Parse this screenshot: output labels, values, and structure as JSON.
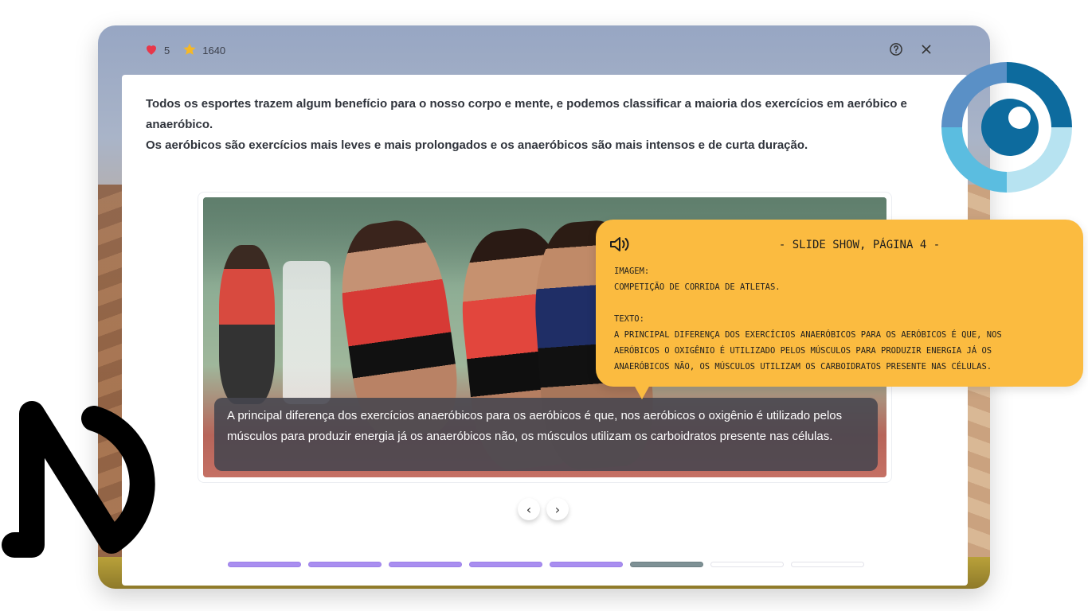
{
  "status": {
    "lives": "5",
    "points": "1640"
  },
  "intro": {
    "line1": "Todos os esportes trazem algum benefício para o nosso corpo e mente, e podemos classificar a maioria dos exercícios em aeróbico e anaeróbico.",
    "line2": "Os aeróbicos são exercícios mais leves e mais prolongados e os anaeróbicos são mais intensos e de curta duração."
  },
  "slide": {
    "caption": "A principal diferença dos exercícios anaeróbicos para os aeróbicos é que, nos aeróbicos o oxigênio é utilizado pelos músculos para produzir energia já os anaeróbicos não, os músculos utilizam os carboidratos presente nas células."
  },
  "nav": {
    "prev": "‹",
    "next": "›"
  },
  "progress": {
    "total": 8,
    "completed": 5,
    "current_index": 6
  },
  "reader": {
    "title": "- SLIDE SHOW, PÁGINA 4 -",
    "image_label": "IMAGEM:",
    "image_text": "COMPETIÇÃO DE CORRIDA DE ATLETAS.",
    "text_label": "TEXTO:",
    "text_line1": "A PRINCIPAL DIFERENÇA DOS EXERCÍCIOS ANAERÓBICOS PARA OS AERÓBICOS É QUE, NOS",
    "text_line2": "AERÓBICOS O OXIGÊNIO É UTILIZADO PELOS MÚSCULOS PARA PRODUZIR ENERGIA JÁ OS",
    "text_line3": "ANAERÓBICOS NÃO, OS MÚSCULOS UTILIZAM OS CARBOIDRATOS PRESENTE NAS CÉLULAS."
  },
  "icons": {
    "lives": "heart-icon",
    "points": "star-icon",
    "help": "help-circle-icon",
    "close": "close-icon",
    "speaker": "speaker-icon",
    "accessibility": "eye-accessibility-logo",
    "brand": "nd-logo"
  },
  "colors": {
    "heart": "#e8374a",
    "star": "#f6b826",
    "tooltip": "#fbbb40",
    "progress_done": "#a98ef0",
    "progress_current": "#7e9195"
  }
}
